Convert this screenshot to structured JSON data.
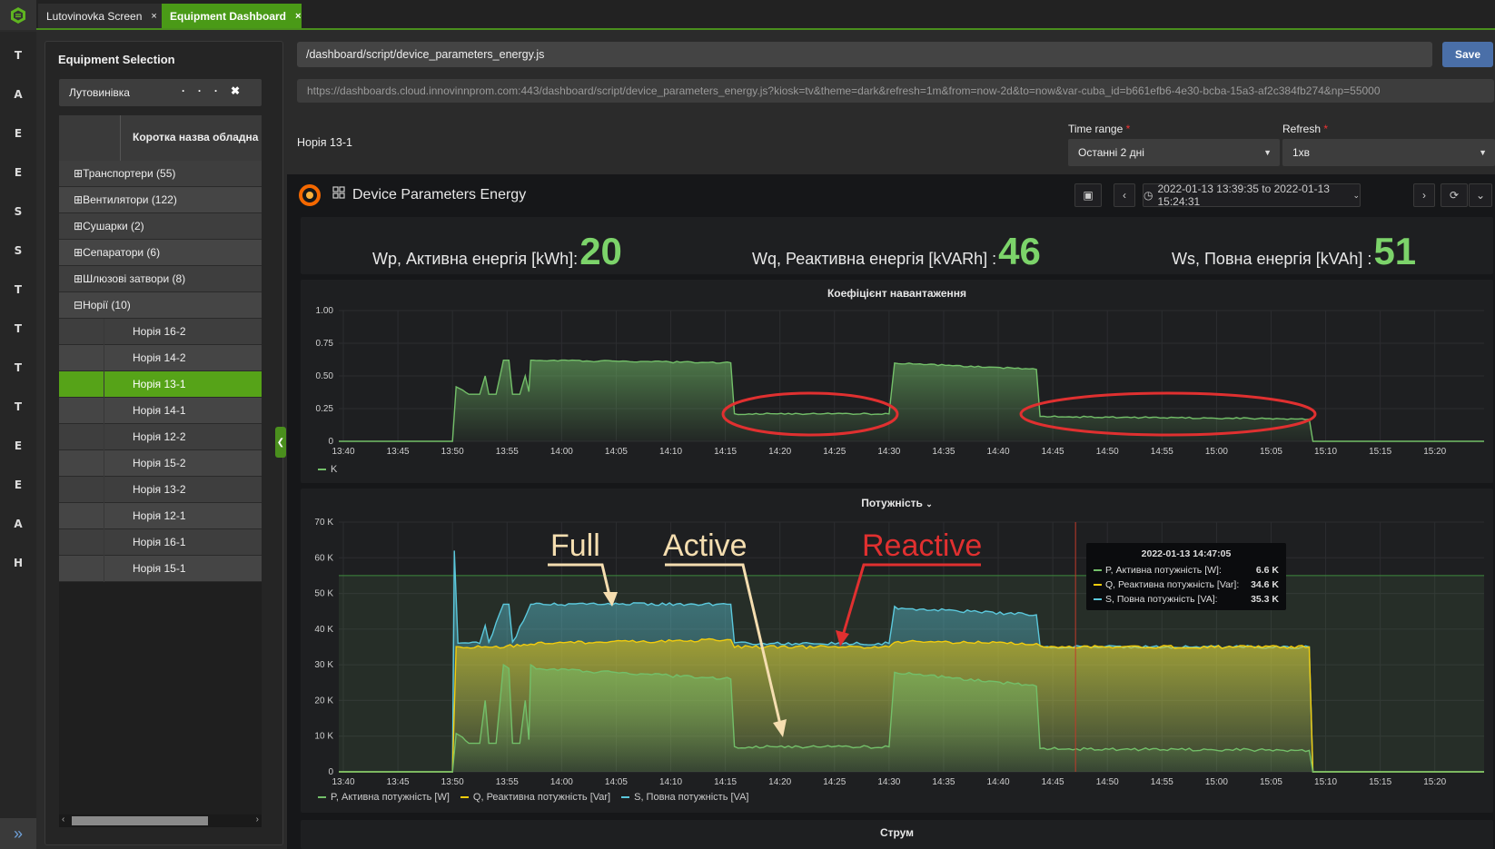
{
  "tabs": [
    {
      "label": "Lutovinovka Screen",
      "close": "×"
    },
    {
      "label": "Equipment Dashboard",
      "close": "×"
    }
  ],
  "rail_letters": [
    "T",
    "A",
    "E",
    "E",
    "S",
    "S",
    "T",
    "T",
    "T",
    "T",
    "E",
    "E",
    "A",
    "H"
  ],
  "rail_toggle": "»",
  "equipment": {
    "title": "Equipment Selection",
    "select_value": "Лутовинівка",
    "select_menu": "···",
    "select_clear": "✖",
    "column_header": "Коротка назва обладна",
    "groups": [
      {
        "label": "Транспортери (55)",
        "state": "⊞"
      },
      {
        "label": "Вентилятори (122)",
        "state": "⊞"
      },
      {
        "label": "Сушарки (2)",
        "state": "⊞"
      },
      {
        "label": "Сепаратори (6)",
        "state": "⊞"
      },
      {
        "label": "Шлюзові затвори (8)",
        "state": "⊞"
      },
      {
        "label": "Норії (10)",
        "state": "⊟"
      }
    ],
    "items": [
      "Норія 16-2",
      "Норія 14-2",
      "Норія 13-1",
      "Норія 14-1",
      "Норія 12-2",
      "Норія 15-2",
      "Норія 13-2",
      "Норія 12-1",
      "Норія 16-1",
      "Норія 15-1"
    ],
    "selected_item": "Норія 13-1"
  },
  "toolbar": {
    "path": "/dashboard/script/device_parameters_energy.js",
    "save_label": "Save",
    "url": "https://dashboards.cloud.innovinnprom.com:443/dashboard/script/device_parameters_energy.js?kiosk=tv&theme=dark&refresh=1m&from=now-2d&to=now&var-cuba_id=b661efb6-4e30-bcba-15a3-af2c384fb274&np=55000"
  },
  "device_name": "Норія 13-1",
  "filters": {
    "time_range_label": "Time range",
    "time_range_value": "Останні 2 дні",
    "refresh_label": "Refresh",
    "refresh_value": "1хв",
    "required_mark": "*"
  },
  "grafana": {
    "dashboard_title": "Device Parameters Energy",
    "time_range": "2022-01-13 13:39:35 to 2022-01-13 15:24:31",
    "stats": [
      {
        "label": "Wp, Активна енергія [kWh]:",
        "value": "20"
      },
      {
        "label": "Wq, Реактивна енергія [kVARh] :",
        "value": "46"
      },
      {
        "label": "Ws, Повна енергія [kVAh] :",
        "value": "51"
      }
    ],
    "panel_struma": "Струм"
  },
  "annotations": {
    "full": "Full",
    "active": "Active",
    "reactive": "Reactive"
  },
  "tooltip": {
    "time": "2022-01-13 14:47:05",
    "rows": [
      {
        "name": "P, Активна потужність [W]:",
        "value": "6.6 K",
        "color": "#73bf69"
      },
      {
        "name": "Q, Реактивна потужність [Var]:",
        "value": "34.6 K",
        "color": "#f2cc0c"
      },
      {
        "name": "S, Повна потужність [VA]:",
        "value": "35.3 K",
        "color": "#5bc8dc"
      }
    ]
  },
  "chart_data": [
    {
      "type": "line",
      "title": "Коефіцієнт навантаження",
      "xlabel": "",
      "ylabel": "",
      "x_ticks": [
        "13:40",
        "13:45",
        "13:50",
        "13:55",
        "14:00",
        "14:05",
        "14:10",
        "14:15",
        "14:20",
        "14:25",
        "14:30",
        "14:35",
        "14:40",
        "14:45",
        "14:50",
        "14:55",
        "15:00",
        "15:05",
        "15:10",
        "15:15",
        "15:20"
      ],
      "y_ticks": [
        "0",
        "0.25",
        "0.50",
        "0.75",
        "1.00"
      ],
      "ylim": [
        0,
        1.0
      ],
      "xlim": [
        "13:39:35",
        "15:24:31"
      ],
      "grid": true,
      "legend_position": "bottom-left",
      "series": [
        {
          "name": "K",
          "color": "#73bf69",
          "x": [
            "13:39:35",
            "13:50:00",
            "13:50:20",
            "13:51:30",
            "13:52:30",
            "13:53:00",
            "13:53:20",
            "13:54:00",
            "13:54:40",
            "13:55:10",
            "13:55:30",
            "13:56:10",
            "13:56:40",
            "13:57:00",
            "13:57:10",
            "13:57:40",
            "14:15:30",
            "14:15:50",
            "14:30:00",
            "14:30:30",
            "14:43:30",
            "14:43:50",
            "15:08:30",
            "15:08:50",
            "15:24:31"
          ],
          "y": [
            0,
            0,
            0.42,
            0.36,
            0.36,
            0.5,
            0.36,
            0.36,
            0.62,
            0.62,
            0.36,
            0.36,
            0.5,
            0.38,
            0.62,
            0.62,
            0.6,
            0.21,
            0.21,
            0.6,
            0.55,
            0.19,
            0.17,
            0,
            0
          ]
        }
      ]
    },
    {
      "type": "area",
      "title": "Потужність",
      "xlabel": "",
      "ylabel": "",
      "x_ticks": [
        "13:40",
        "13:45",
        "13:50",
        "13:55",
        "14:00",
        "14:05",
        "14:10",
        "14:15",
        "14:20",
        "14:25",
        "14:30",
        "14:35",
        "14:40",
        "14:45",
        "14:50",
        "14:55",
        "15:00",
        "15:05",
        "15:10",
        "15:15",
        "15:20"
      ],
      "y_ticks": [
        "0",
        "10 K",
        "20 K",
        "30 K",
        "40 K",
        "50 K",
        "60 K",
        "70 K"
      ],
      "ylim": [
        0,
        70000
      ],
      "xlim": [
        "13:39:35",
        "15:24:31"
      ],
      "grid": true,
      "legend_position": "bottom-left",
      "threshold": 55000,
      "cursor": "14:47:05",
      "series": [
        {
          "name": "P, Активна потужність [W]",
          "color": "#73bf69",
          "x": [
            "13:39:35",
            "13:50:00",
            "13:50:20",
            "13:51:30",
            "13:52:30",
            "13:53:00",
            "13:53:20",
            "13:54:00",
            "13:54:40",
            "13:55:10",
            "13:55:30",
            "13:56:10",
            "13:56:40",
            "13:57:00",
            "13:57:10",
            "13:57:40",
            "14:15:30",
            "14:15:50",
            "14:30:00",
            "14:30:30",
            "14:43:30",
            "14:43:50",
            "15:08:30",
            "15:08:50",
            "15:24:31"
          ],
          "y": [
            0,
            0,
            11000,
            8000,
            8000,
            20000,
            8000,
            8000,
            30000,
            29000,
            8000,
            8000,
            20000,
            9000,
            30000,
            29000,
            26000,
            7000,
            7000,
            28000,
            24000,
            6500,
            6000,
            0,
            0
          ]
        },
        {
          "name": "Q, Реактивна потужність [Var]",
          "color": "#f2cc0c",
          "x": [
            "13:39:35",
            "13:50:00",
            "13:50:20",
            "13:54:40",
            "13:57:10",
            "14:15:30",
            "14:15:50",
            "14:30:00",
            "14:30:30",
            "14:43:30",
            "14:43:50",
            "15:08:30",
            "15:08:50",
            "15:24:31"
          ],
          "y": [
            0,
            0,
            35000,
            35000,
            36000,
            37000,
            35000,
            35000,
            36500,
            36000,
            35000,
            35000,
            0,
            0
          ]
        },
        {
          "name": "S, Повна потужність [VA]",
          "color": "#5bc8dc",
          "x": [
            "13:39:35",
            "13:50:00",
            "13:50:10",
            "13:50:30",
            "13:52:30",
            "13:53:00",
            "13:53:20",
            "13:54:40",
            "13:55:10",
            "13:55:30",
            "13:57:10",
            "13:57:40",
            "14:15:30",
            "14:15:50",
            "14:30:00",
            "14:30:30",
            "14:43:30",
            "14:43:50",
            "15:08:30",
            "15:08:50",
            "15:24:31"
          ],
          "y": [
            0,
            0,
            62000,
            36000,
            36000,
            41000,
            36000,
            47000,
            47000,
            36000,
            47000,
            47000,
            47000,
            36000,
            36000,
            46000,
            44000,
            35000,
            35000,
            0,
            0
          ]
        }
      ]
    }
  ]
}
